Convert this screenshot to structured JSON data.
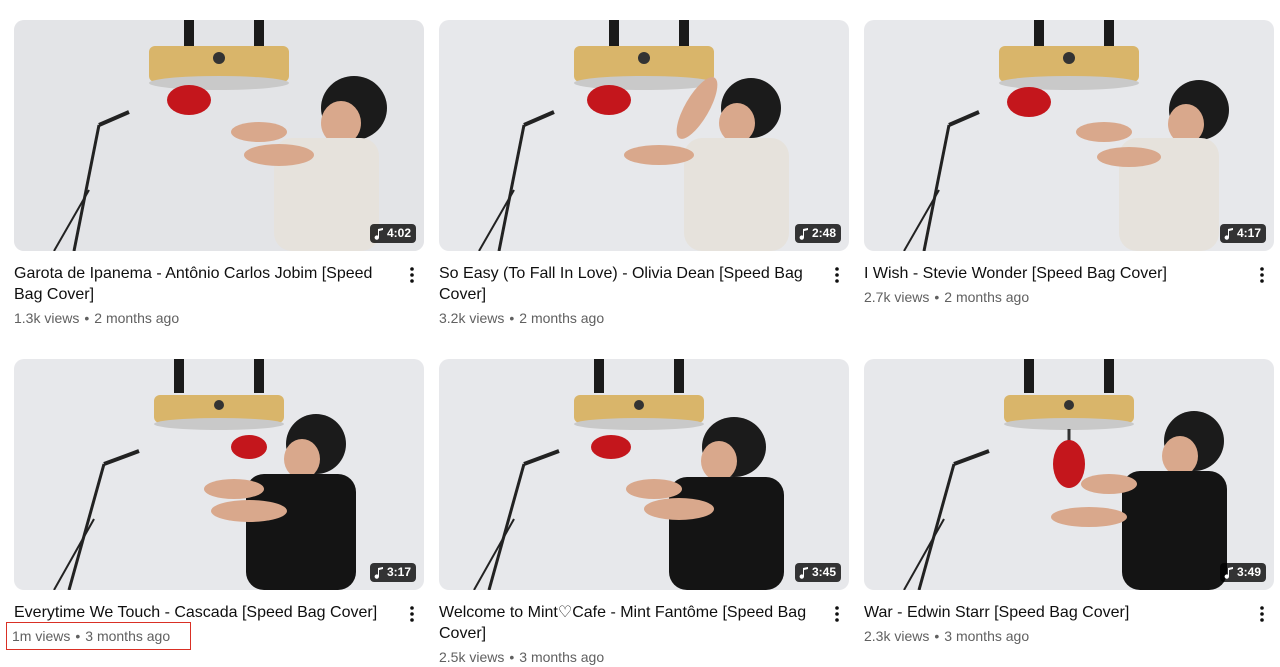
{
  "videos": [
    {
      "title": "Garota de Ipanema - Antônio Carlos Jobim [Speed Bag Cover]",
      "views": "1.3k views",
      "age": "2 months ago",
      "duration": "4:02",
      "shirt": "#e6e2dc"
    },
    {
      "title": "So Easy (To Fall In Love) - Olivia Dean [Speed Bag Cover]",
      "views": "3.2k views",
      "age": "2 months ago",
      "duration": "2:48",
      "shirt": "#e6e2dc"
    },
    {
      "title": "I Wish - Stevie Wonder [Speed Bag Cover]",
      "views": "2.7k views",
      "age": "2 months ago",
      "duration": "4:17",
      "shirt": "#e6e2dc"
    },
    {
      "title": "Everytime We Touch - Cascada [Speed Bag Cover]",
      "views": "1m views",
      "age": "3 months ago",
      "duration": "3:17",
      "shirt": "#141414"
    },
    {
      "title": "Welcome to Mint♡Cafe - Mint Fantôme [Speed Bag Cover]",
      "views": "2.5k views",
      "age": "3 months ago",
      "duration": "3:45",
      "shirt": "#141414"
    },
    {
      "title": "War - Edwin Starr [Speed Bag Cover]",
      "views": "2.3k views",
      "age": "3 months ago",
      "duration": "3:49",
      "shirt": "#141414"
    }
  ],
  "separator": "•",
  "icons": {
    "duration": "music-note-icon",
    "menu": "more-vert-icon"
  },
  "colors": {
    "highlight": "#d93025",
    "meta_text": "#606060",
    "title_text": "#0f0f0f",
    "bag": "#c4161c"
  }
}
